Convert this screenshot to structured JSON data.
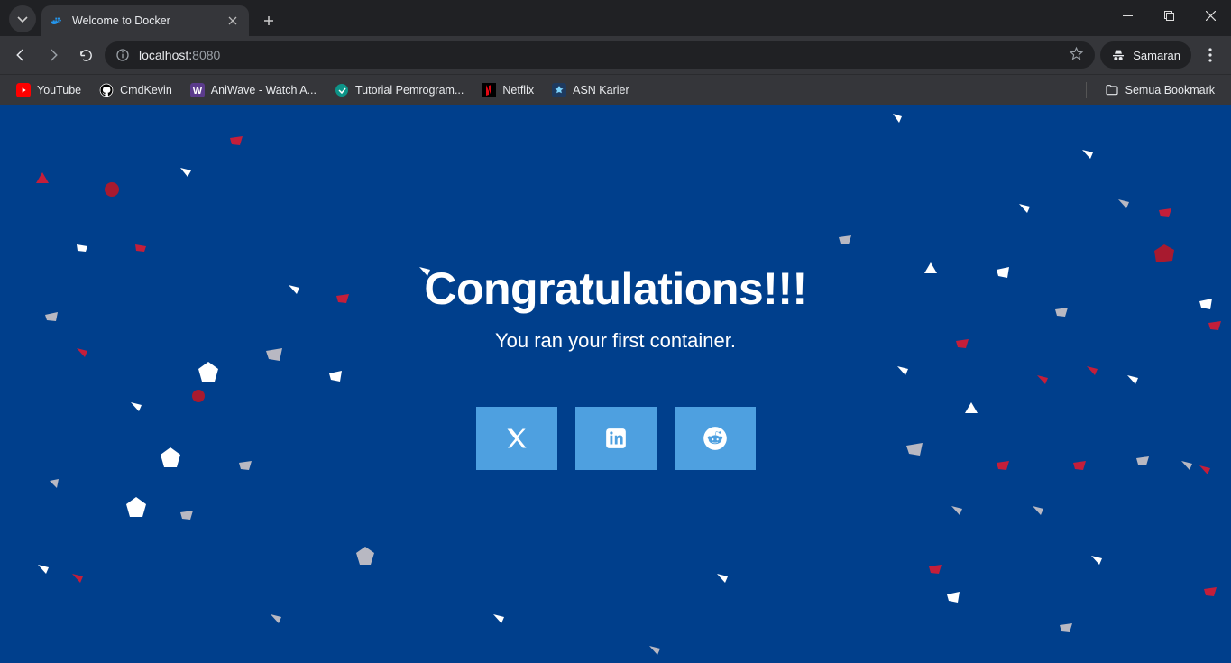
{
  "browser": {
    "tab": {
      "title": "Welcome to Docker"
    },
    "url": {
      "host": "localhost:",
      "port": "8080"
    },
    "profile_label": "Samaran",
    "bookmarks": [
      {
        "label": "YouTube",
        "icon": "youtube"
      },
      {
        "label": "CmdKevin",
        "icon": "github"
      },
      {
        "label": "AniWave - Watch A...",
        "icon": "aniwave"
      },
      {
        "label": "Tutorial Pemrogram...",
        "icon": "teal-dot"
      },
      {
        "label": "Netflix",
        "icon": "netflix"
      },
      {
        "label": "ASN Karier",
        "icon": "asn"
      }
    ],
    "all_bookmarks_label": "Semua Bookmark"
  },
  "page": {
    "headline": "Congratulations!!!",
    "subhead": "You ran your first container.",
    "share": {
      "twitter": "X",
      "linkedin": "LinkedIn",
      "reddit": "Reddit"
    }
  },
  "colors": {
    "page_bg": "#003f8c",
    "share_btn": "#4ea0e0",
    "confetti_white": "#ffffff",
    "confetti_red": "#c41e3a",
    "confetti_grey": "#b8b8c2"
  }
}
